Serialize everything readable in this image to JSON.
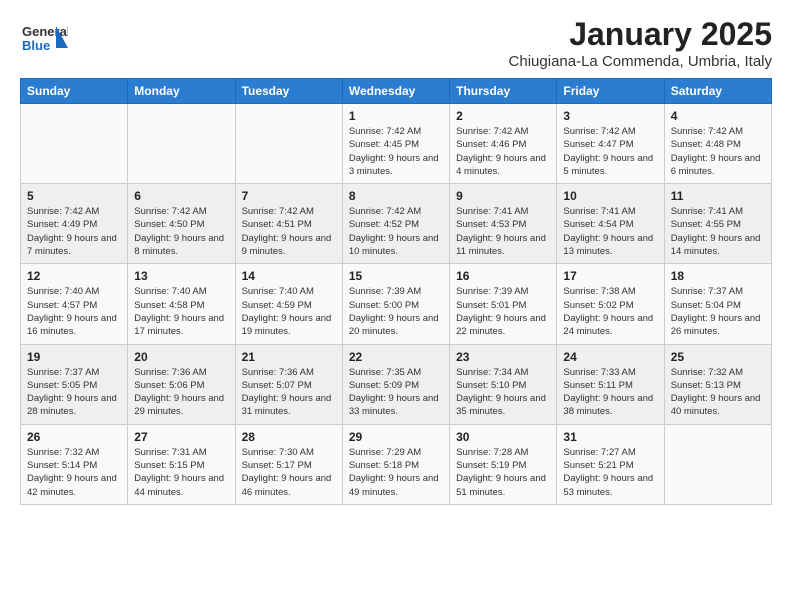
{
  "header": {
    "logo_general": "General",
    "logo_blue": "Blue",
    "month_title": "January 2025",
    "subtitle": "Chiugiana-La Commenda, Umbria, Italy"
  },
  "calendar": {
    "weekdays": [
      "Sunday",
      "Monday",
      "Tuesday",
      "Wednesday",
      "Thursday",
      "Friday",
      "Saturday"
    ],
    "weeks": [
      [
        {
          "day": "",
          "info": ""
        },
        {
          "day": "",
          "info": ""
        },
        {
          "day": "",
          "info": ""
        },
        {
          "day": "1",
          "info": "Sunrise: 7:42 AM\nSunset: 4:45 PM\nDaylight: 9 hours and 3 minutes."
        },
        {
          "day": "2",
          "info": "Sunrise: 7:42 AM\nSunset: 4:46 PM\nDaylight: 9 hours and 4 minutes."
        },
        {
          "day": "3",
          "info": "Sunrise: 7:42 AM\nSunset: 4:47 PM\nDaylight: 9 hours and 5 minutes."
        },
        {
          "day": "4",
          "info": "Sunrise: 7:42 AM\nSunset: 4:48 PM\nDaylight: 9 hours and 6 minutes."
        }
      ],
      [
        {
          "day": "5",
          "info": "Sunrise: 7:42 AM\nSunset: 4:49 PM\nDaylight: 9 hours and 7 minutes."
        },
        {
          "day": "6",
          "info": "Sunrise: 7:42 AM\nSunset: 4:50 PM\nDaylight: 9 hours and 8 minutes."
        },
        {
          "day": "7",
          "info": "Sunrise: 7:42 AM\nSunset: 4:51 PM\nDaylight: 9 hours and 9 minutes."
        },
        {
          "day": "8",
          "info": "Sunrise: 7:42 AM\nSunset: 4:52 PM\nDaylight: 9 hours and 10 minutes."
        },
        {
          "day": "9",
          "info": "Sunrise: 7:41 AM\nSunset: 4:53 PM\nDaylight: 9 hours and 11 minutes."
        },
        {
          "day": "10",
          "info": "Sunrise: 7:41 AM\nSunset: 4:54 PM\nDaylight: 9 hours and 13 minutes."
        },
        {
          "day": "11",
          "info": "Sunrise: 7:41 AM\nSunset: 4:55 PM\nDaylight: 9 hours and 14 minutes."
        }
      ],
      [
        {
          "day": "12",
          "info": "Sunrise: 7:40 AM\nSunset: 4:57 PM\nDaylight: 9 hours and 16 minutes."
        },
        {
          "day": "13",
          "info": "Sunrise: 7:40 AM\nSunset: 4:58 PM\nDaylight: 9 hours and 17 minutes."
        },
        {
          "day": "14",
          "info": "Sunrise: 7:40 AM\nSunset: 4:59 PM\nDaylight: 9 hours and 19 minutes."
        },
        {
          "day": "15",
          "info": "Sunrise: 7:39 AM\nSunset: 5:00 PM\nDaylight: 9 hours and 20 minutes."
        },
        {
          "day": "16",
          "info": "Sunrise: 7:39 AM\nSunset: 5:01 PM\nDaylight: 9 hours and 22 minutes."
        },
        {
          "day": "17",
          "info": "Sunrise: 7:38 AM\nSunset: 5:02 PM\nDaylight: 9 hours and 24 minutes."
        },
        {
          "day": "18",
          "info": "Sunrise: 7:37 AM\nSunset: 5:04 PM\nDaylight: 9 hours and 26 minutes."
        }
      ],
      [
        {
          "day": "19",
          "info": "Sunrise: 7:37 AM\nSunset: 5:05 PM\nDaylight: 9 hours and 28 minutes."
        },
        {
          "day": "20",
          "info": "Sunrise: 7:36 AM\nSunset: 5:06 PM\nDaylight: 9 hours and 29 minutes."
        },
        {
          "day": "21",
          "info": "Sunrise: 7:36 AM\nSunset: 5:07 PM\nDaylight: 9 hours and 31 minutes."
        },
        {
          "day": "22",
          "info": "Sunrise: 7:35 AM\nSunset: 5:09 PM\nDaylight: 9 hours and 33 minutes."
        },
        {
          "day": "23",
          "info": "Sunrise: 7:34 AM\nSunset: 5:10 PM\nDaylight: 9 hours and 35 minutes."
        },
        {
          "day": "24",
          "info": "Sunrise: 7:33 AM\nSunset: 5:11 PM\nDaylight: 9 hours and 38 minutes."
        },
        {
          "day": "25",
          "info": "Sunrise: 7:32 AM\nSunset: 5:13 PM\nDaylight: 9 hours and 40 minutes."
        }
      ],
      [
        {
          "day": "26",
          "info": "Sunrise: 7:32 AM\nSunset: 5:14 PM\nDaylight: 9 hours and 42 minutes."
        },
        {
          "day": "27",
          "info": "Sunrise: 7:31 AM\nSunset: 5:15 PM\nDaylight: 9 hours and 44 minutes."
        },
        {
          "day": "28",
          "info": "Sunrise: 7:30 AM\nSunset: 5:17 PM\nDaylight: 9 hours and 46 minutes."
        },
        {
          "day": "29",
          "info": "Sunrise: 7:29 AM\nSunset: 5:18 PM\nDaylight: 9 hours and 49 minutes."
        },
        {
          "day": "30",
          "info": "Sunrise: 7:28 AM\nSunset: 5:19 PM\nDaylight: 9 hours and 51 minutes."
        },
        {
          "day": "31",
          "info": "Sunrise: 7:27 AM\nSunset: 5:21 PM\nDaylight: 9 hours and 53 minutes."
        },
        {
          "day": "",
          "info": ""
        }
      ]
    ]
  }
}
